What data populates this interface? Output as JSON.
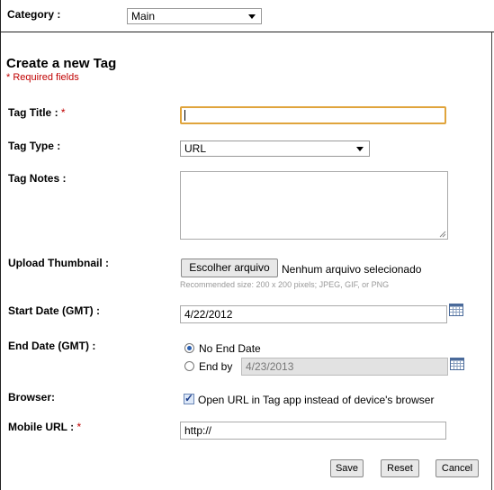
{
  "category": {
    "label": "Category :",
    "value": "Main"
  },
  "form": {
    "heading": "Create a new Tag",
    "required_note": "* Required fields",
    "tag_title": {
      "label": "Tag Title :",
      "required_mark": "*",
      "value": ""
    },
    "tag_type": {
      "label": "Tag Type :",
      "value": "URL"
    },
    "tag_notes": {
      "label": "Tag Notes :",
      "value": ""
    },
    "upload": {
      "label": "Upload Thumbnail :",
      "button": "Escolher arquivo",
      "status": "Nenhum arquivo selecionado",
      "hint": "Recommended size: 200 x 200 pixels; JPEG, GIF, or PNG"
    },
    "start_date": {
      "label": "Start Date (GMT) :",
      "value": "4/22/2012"
    },
    "end_date": {
      "label": "End Date (GMT) :",
      "option_none": "No End Date",
      "option_by": "End by",
      "selected": "none",
      "value": "4/23/2013"
    },
    "browser": {
      "label": "Browser:",
      "checkbox_label": "Open URL in Tag app instead of device's browser",
      "checked": true
    },
    "mobile_url": {
      "label": "Mobile URL :",
      "required_mark": "*",
      "value": "http://"
    }
  },
  "actions": {
    "save": "Save",
    "reset": "Reset",
    "cancel": "Cancel"
  },
  "colors": {
    "required": "#c00000",
    "focus_border": "#e0a43c"
  }
}
